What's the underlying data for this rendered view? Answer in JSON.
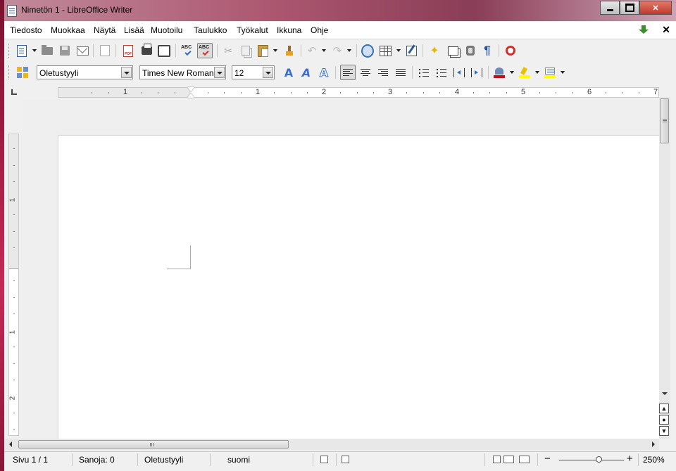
{
  "window": {
    "title": "Nimetön 1 - LibreOffice Writer"
  },
  "menubar": {
    "items": [
      "Tiedosto",
      "Muokkaa",
      "Näytä",
      "Lisää",
      "Muotoilu",
      "Taulukko",
      "Työkalut",
      "Ikkuna",
      "Ohje"
    ]
  },
  "standard_toolbar": {
    "icons": [
      "new-document-icon",
      "open-folder-icon",
      "save-icon",
      "email-icon",
      "edit-file-icon",
      "export-pdf-icon",
      "print-icon",
      "print-preview-icon",
      "spellcheck-icon",
      "autospellcheck-icon",
      "cut-icon",
      "copy-icon",
      "paste-icon",
      "clone-formatting-icon",
      "undo-icon",
      "redo-icon",
      "navigator-icon",
      "table-icon",
      "show-draw-functions-icon",
      "gallery-icon",
      "frames-icon",
      "data-sources-icon",
      "formatting-marks-icon",
      "help-icon"
    ]
  },
  "formatting_toolbar": {
    "paragraph_style": "Oletustyyli",
    "font_name": "Times New Roman",
    "font_size": "12",
    "pressed_alignment": "align-left"
  },
  "ruler": {
    "horizontal_labels": [
      "1",
      "1",
      "2",
      "3",
      "4",
      "5",
      "6",
      "7"
    ],
    "vertical_labels": [
      "1",
      "1",
      "2"
    ]
  },
  "statusbar": {
    "page": "Sivu 1 / 1",
    "words": "Sanoja: 0",
    "style": "Oletustyyli",
    "language": "suomi",
    "zoom": "250%"
  },
  "colors": {
    "accent": "#3a6fd0",
    "font_color": "#c0101a",
    "highlight": "#ffff00"
  }
}
